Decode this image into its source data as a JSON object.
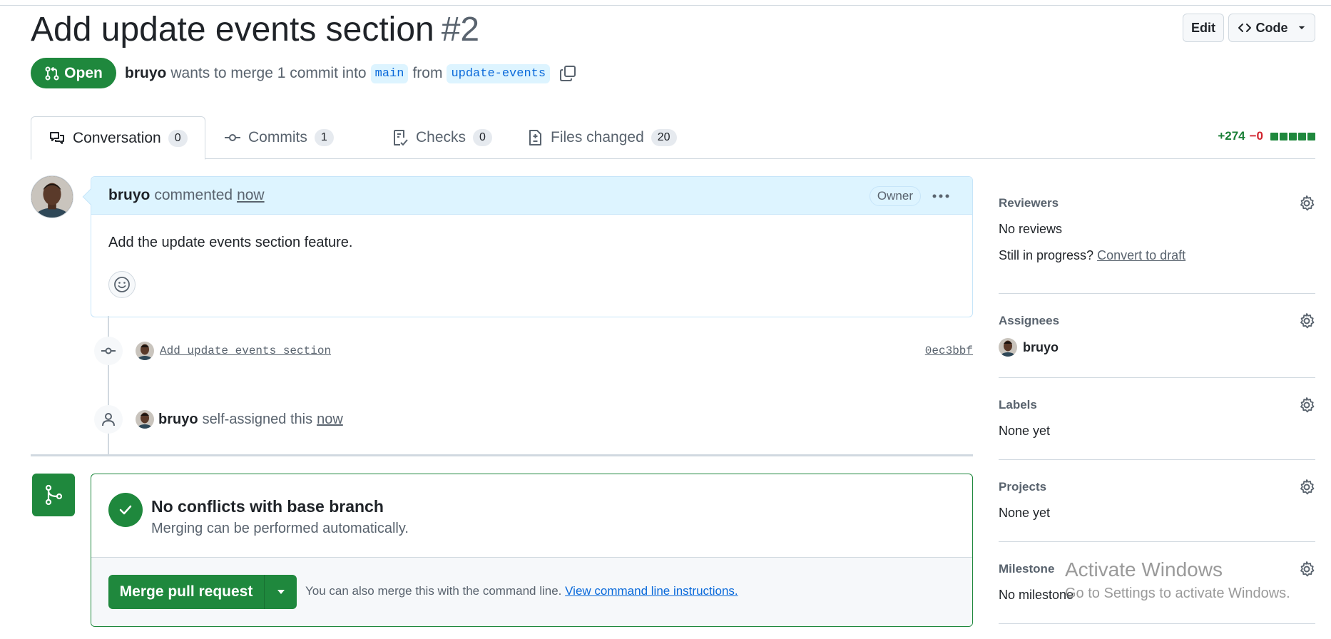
{
  "header": {
    "title": "Add update events section",
    "number": "#2",
    "edit_label": "Edit",
    "code_label": "Code"
  },
  "status": {
    "state": "Open",
    "author": "bruyo",
    "merge_text": "wants to merge 1 commit into",
    "base_branch": "main",
    "from_text": "from",
    "head_branch": "update-events"
  },
  "tabs": [
    {
      "label": "Conversation",
      "count": "0",
      "icon": "comment-discussion-icon"
    },
    {
      "label": "Commits",
      "count": "1",
      "icon": "git-commit-icon"
    },
    {
      "label": "Checks",
      "count": "0",
      "icon": "checklist-icon"
    },
    {
      "label": "Files changed",
      "count": "20",
      "icon": "file-diff-icon"
    }
  ],
  "diffstat": {
    "additions": "+274",
    "deletions": "−0"
  },
  "comment": {
    "author": "bruyo",
    "action": "commented",
    "time": "now",
    "badge": "Owner",
    "body": "Add the update events section feature."
  },
  "commit_event": {
    "message": "Add update events section",
    "sha": "0ec3bbf"
  },
  "assign_event": {
    "author": "bruyo",
    "text": "self-assigned this",
    "time": "now"
  },
  "merge": {
    "title": "No conflicts with base branch",
    "subtitle": "Merging can be performed automatically.",
    "button_label": "Merge pull request",
    "note": "You can also merge this with the command line.",
    "link": "View command line instructions."
  },
  "sidebar": {
    "reviewers": {
      "title": "Reviewers",
      "value": "No reviews",
      "hint": "Still in progress?",
      "hint_link": "Convert to draft"
    },
    "assignees": {
      "title": "Assignees",
      "user": "bruyo"
    },
    "labels": {
      "title": "Labels",
      "value": "None yet"
    },
    "projects": {
      "title": "Projects",
      "value": "None yet"
    },
    "milestone": {
      "title": "Milestone",
      "value": "No milestone"
    }
  },
  "watermark": {
    "line1": "Activate Windows",
    "line2": "Go to Settings to activate Windows."
  },
  "colors": {
    "open_green": "#1f883d",
    "link_blue": "#0969da",
    "comment_header_bg": "#ddf4ff"
  }
}
